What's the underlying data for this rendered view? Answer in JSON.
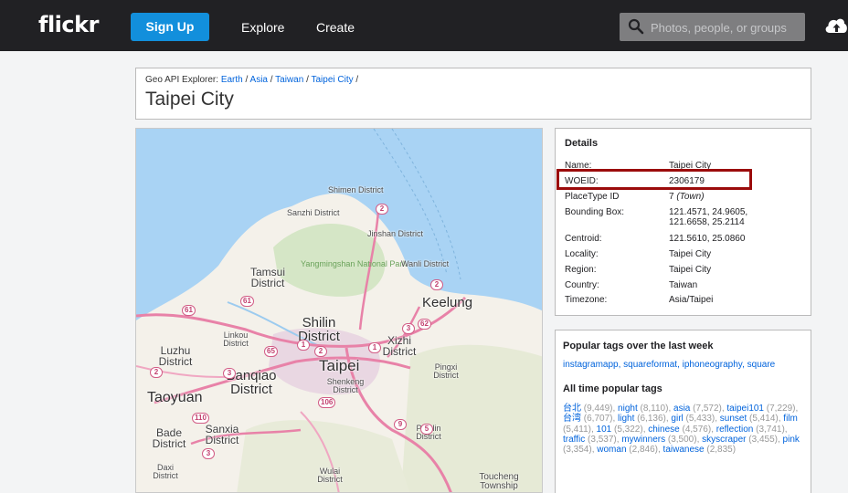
{
  "topbar": {
    "logo": "flickr",
    "signup_label": "Sign Up",
    "nav": [
      "Explore",
      "Create"
    ],
    "search_placeholder": "Photos, people, or groups"
  },
  "header": {
    "breadcrumb_prefix": "Geo API Explorer:",
    "breadcrumb": [
      "Earth",
      "Asia",
      "Taiwan",
      "Taipei City"
    ],
    "separator": "/",
    "title": "Taipei City"
  },
  "map": {
    "labels": [
      "Shimen District",
      "Sanzhi District",
      "Jinshan District",
      "Yangmingshan National Park",
      "Wanli District",
      "Tamsui District",
      "Keelung",
      "Shilin District",
      "Linkou District",
      "Xizhi District",
      "Luzhu District",
      "Taipei",
      "Banqiao District",
      "Shenkeng District",
      "Pingxi District",
      "Taoyuan",
      "Bade District",
      "Sanxia District",
      "Pinglin District",
      "Daxi District",
      "Wulai District",
      "Toucheng Township"
    ],
    "road_shields": [
      "2",
      "2",
      "61",
      "62",
      "61",
      "65",
      "3",
      "1",
      "106",
      "110",
      "5",
      "9",
      "3",
      "2",
      "3",
      "1",
      "2"
    ]
  },
  "details": {
    "heading": "Details",
    "rows": [
      {
        "label": "Name:",
        "value": "Taipei City"
      },
      {
        "label": "WOEID:",
        "value": "2306179"
      },
      {
        "label": "PlaceType ID",
        "value": "7 (Town)"
      },
      {
        "label": "Bounding Box:",
        "value": "121.4571, 24.9605, 121.6658, 25.2114"
      },
      {
        "label": "Centroid:",
        "value": "121.5610, 25.0860"
      },
      {
        "label": "Locality:",
        "value": "Taipei City"
      },
      {
        "label": "Region:",
        "value": "Taipei City"
      },
      {
        "label": "Country:",
        "value": "Taiwan"
      },
      {
        "label": "Timezone:",
        "value": "Asia/Taipei"
      }
    ]
  },
  "tags": {
    "recent_heading": "Popular tags over the last week",
    "recent": [
      "instagramapp",
      "squareformat",
      "iphoneography",
      "square"
    ],
    "alltime_heading": "All time popular tags",
    "alltime": [
      {
        "tag": "台北",
        "count": "9,449"
      },
      {
        "tag": "night",
        "count": "8,110"
      },
      {
        "tag": "asia",
        "count": "7,572"
      },
      {
        "tag": "taipei101",
        "count": "7,229"
      },
      {
        "tag": "台湾",
        "count": "6,707"
      },
      {
        "tag": "light",
        "count": "6,136"
      },
      {
        "tag": "girl",
        "count": "5,433"
      },
      {
        "tag": "sunset",
        "count": "5,414"
      },
      {
        "tag": "film",
        "count": "5,411"
      },
      {
        "tag": "101",
        "count": "5,322"
      },
      {
        "tag": "chinese",
        "count": "4,576"
      },
      {
        "tag": "reflection",
        "count": "3,741"
      },
      {
        "tag": "traffic",
        "count": "3,537"
      },
      {
        "tag": "mywinners",
        "count": "3,500"
      },
      {
        "tag": "skyscraper",
        "count": "3,455"
      },
      {
        "tag": "pink",
        "count": "3,354"
      },
      {
        "tag": "woman",
        "count": "2,846"
      },
      {
        "tag": "taiwanese",
        "count": "2,835"
      }
    ]
  },
  "colors": {
    "topbar": "#212124",
    "accent": "#128fdc",
    "link": "#0063dc",
    "highlight_box": "#9b0b0b",
    "water": "#a9d3f4",
    "land": "#f4f1ea",
    "road": "#e882a8"
  },
  "icons": [
    "search-icon",
    "upload-cloud-icon"
  ]
}
